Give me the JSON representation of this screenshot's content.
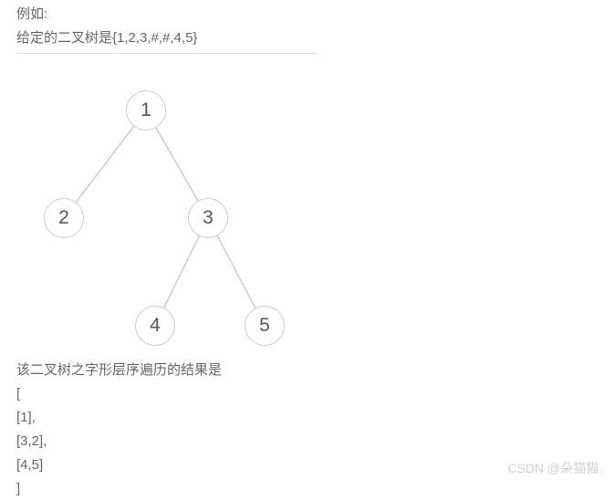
{
  "intro": {
    "example_label": "例如:",
    "given_tree": "给定的二叉树是{1,2,3,#,#,4,5}"
  },
  "tree": {
    "nodes": {
      "n1": "1",
      "n2": "2",
      "n3": "3",
      "n4": "4",
      "n5": "5"
    }
  },
  "output": {
    "desc": "该二叉树之字形层序遍历的结果是",
    "l0": "[",
    "l1": "[1],",
    "l2": "[3,2],",
    "l3": "[4,5]",
    "l4": "]"
  },
  "watermark": "CSDN @朵猫猫."
}
